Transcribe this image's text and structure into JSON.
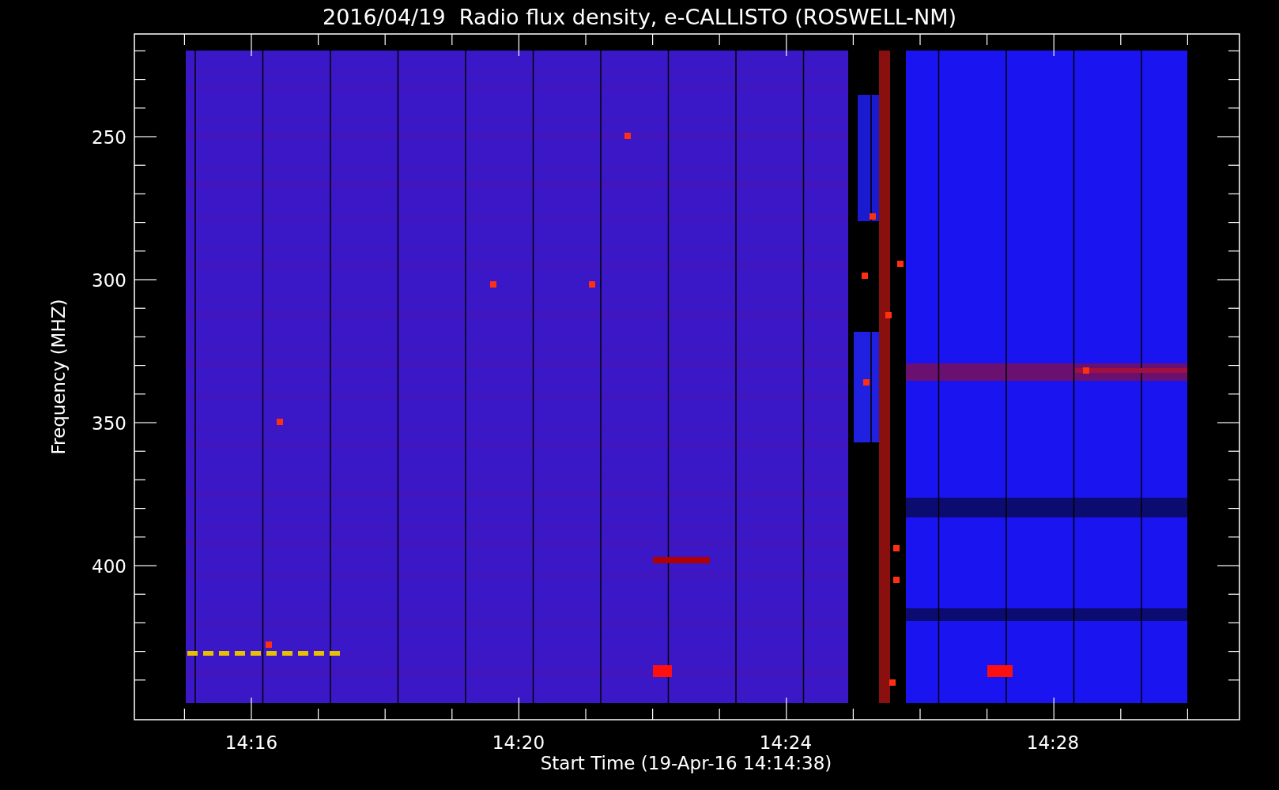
{
  "title": "2016/04/19  Radio flux density, e-CALLISTO (ROSWELL-NM)",
  "y_axis": {
    "label": "Frequency (MHZ)",
    "ticks": [
      "250",
      "300",
      "350",
      "400"
    ]
  },
  "x_axis": {
    "label": "Start Time (19-Apr-16 14:14:38)",
    "ticks": [
      "14:16",
      "14:20",
      "14:24",
      "14:28"
    ]
  }
}
